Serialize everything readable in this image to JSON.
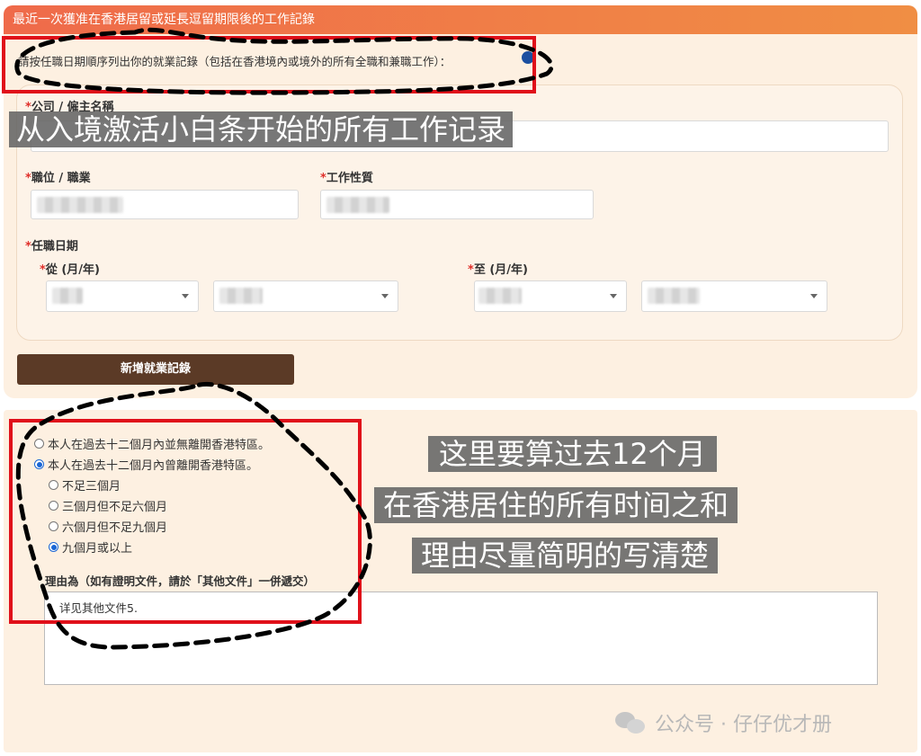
{
  "header": {
    "title": "最近一次獲准在香港居留或延長逗留期限後的工作記錄"
  },
  "instruction": "請按任職日期順序列出你的就業記錄（包括在香港境內或境外的所有全職和兼職工作）：",
  "form": {
    "company_label": "公司 / 僱主名稱",
    "position_label": "職位 / 職業",
    "nature_label": "工作性質",
    "period_label": "任職日期",
    "from_label": "從 (月/年)",
    "to_label": "至 (月/年)",
    "required_mark": "*",
    "add_button": "新增就業記錄"
  },
  "absence": {
    "options": [
      "本人在過去十二個月內並無離開香港特區。",
      "本人在過去十二個月內曾離開香港特區。"
    ],
    "selected": 1,
    "sub_options": [
      "不足三個月",
      "三個月但不足六個月",
      "六個月但不足九個月",
      "九個月或以上"
    ],
    "sub_selected": 3,
    "reason_label": "理由為（如有證明文件，請於「其他文件」一併遞交）",
    "reason_value": "详见其他文件5."
  },
  "annotations": {
    "caption1": "从入境激活小白条开始的所有工作记录",
    "caption2_lines": [
      "这里要算过去12个月",
      "在香港居住的所有时间之和",
      "理由尽量简明的写清楚"
    ],
    "mark_color": "#e0101a",
    "caption_bg": "#646464"
  },
  "watermark": {
    "text": "公众号 · 仔仔优才册",
    "icon": "wechat-icon"
  }
}
